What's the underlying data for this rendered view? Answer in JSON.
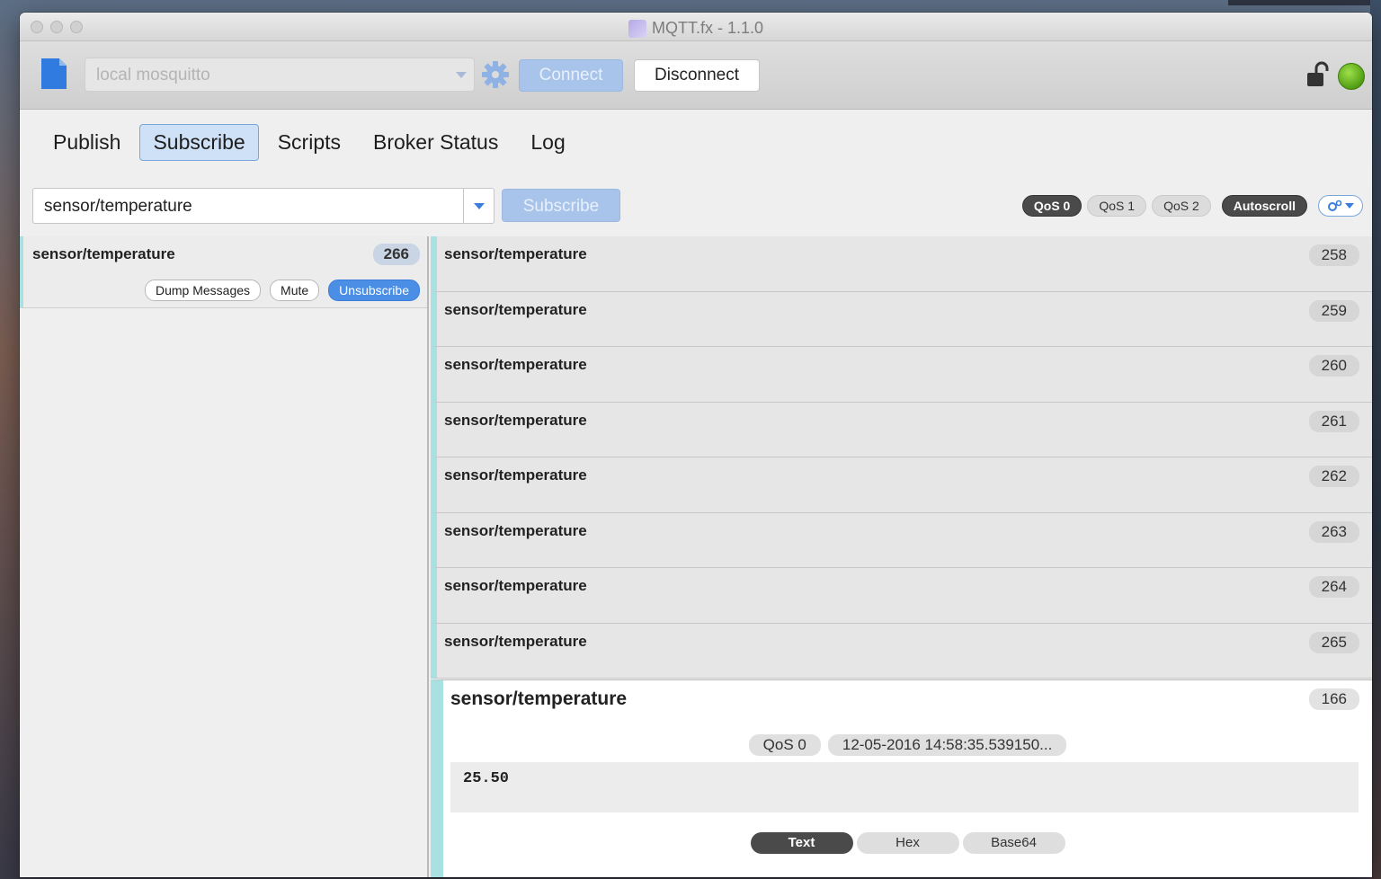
{
  "window": {
    "title": "MQTT.fx - 1.1.0"
  },
  "toolbar": {
    "broker_profile": "local mosquitto",
    "connect_label": "Connect",
    "disconnect_label": "Disconnect",
    "status_color": "#5fb81e"
  },
  "tabs": [
    {
      "label": "Publish",
      "active": false
    },
    {
      "label": "Subscribe",
      "active": true
    },
    {
      "label": "Scripts",
      "active": false
    },
    {
      "label": "Broker Status",
      "active": false
    },
    {
      "label": "Log",
      "active": false
    }
  ],
  "subscribe_bar": {
    "topic_value": "sensor/temperature",
    "subscribe_label": "Subscribe",
    "qos": [
      "QoS 0",
      "QoS 1",
      "QoS 2"
    ],
    "selected_qos": "QoS 0",
    "autoscroll_label": "Autoscroll"
  },
  "subscriptions": [
    {
      "topic": "sensor/temperature",
      "count": "266",
      "dump_label": "Dump Messages",
      "mute_label": "Mute",
      "unsubscribe_label": "Unsubscribe"
    }
  ],
  "messages": [
    {
      "topic": "sensor/temperature",
      "number": "258"
    },
    {
      "topic": "sensor/temperature",
      "number": "259"
    },
    {
      "topic": "sensor/temperature",
      "number": "260"
    },
    {
      "topic": "sensor/temperature",
      "number": "261"
    },
    {
      "topic": "sensor/temperature",
      "number": "262"
    },
    {
      "topic": "sensor/temperature",
      "number": "263"
    },
    {
      "topic": "sensor/temperature",
      "number": "264"
    },
    {
      "topic": "sensor/temperature",
      "number": "265"
    }
  ],
  "detail": {
    "topic": "sensor/temperature",
    "number": "166",
    "qos": "QoS 0",
    "timestamp": "12-05-2016  14:58:35.539150...",
    "payload": "25.50",
    "formats": [
      "Text",
      "Hex",
      "Base64"
    ],
    "selected_format": "Text"
  },
  "accent_color": "#3b7ddd"
}
